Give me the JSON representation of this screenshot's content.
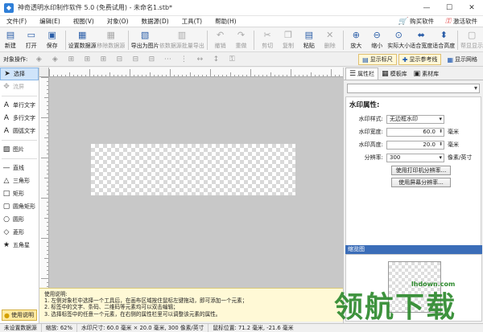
{
  "window": {
    "title": "神奇透明水印制作软件 5.0 (免费试用) - 未命名1.stb*",
    "minimize": "—",
    "maximize": "☐",
    "close": "✕"
  },
  "menu": {
    "items": [
      "文件(F)",
      "编辑(E)",
      "视图(V)",
      "对象(O)",
      "数据源(D)",
      "工具(T)",
      "帮助(H)"
    ],
    "buy": "购买软件",
    "activate": "激活软件"
  },
  "toolbar": [
    {
      "label": "新建",
      "icon": "new-file-icon",
      "glyph": "▤",
      "disabled": false
    },
    {
      "label": "打开",
      "icon": "open-folder-icon",
      "glyph": "▭",
      "disabled": false
    },
    {
      "label": "保存",
      "icon": "save-icon",
      "glyph": "▣",
      "disabled": false
    },
    {
      "label": "设置数据源",
      "icon": "datasource-icon",
      "glyph": "▦",
      "disabled": false
    },
    {
      "label": "移除数据源",
      "icon": "remove-datasource-icon",
      "glyph": "▦",
      "disabled": true
    },
    {
      "label": "导出为图片",
      "icon": "export-image-icon",
      "glyph": "▧",
      "disabled": false
    },
    {
      "label": "依数据源批量导出",
      "icon": "batch-export-icon",
      "glyph": "▥",
      "disabled": true
    },
    {
      "label": "撤销",
      "icon": "undo-icon",
      "glyph": "↶",
      "disabled": true
    },
    {
      "label": "重做",
      "icon": "redo-icon",
      "glyph": "↷",
      "disabled": true
    },
    {
      "label": "剪切",
      "icon": "cut-icon",
      "glyph": "✂",
      "disabled": true
    },
    {
      "label": "复制",
      "icon": "copy-icon",
      "glyph": "❐",
      "disabled": true
    },
    {
      "label": "粘贴",
      "icon": "paste-icon",
      "glyph": "▤",
      "disabled": false
    },
    {
      "label": "删除",
      "icon": "delete-icon",
      "glyph": "✕",
      "disabled": true
    },
    {
      "label": "放大",
      "icon": "zoom-in-icon",
      "glyph": "⊕",
      "disabled": false
    },
    {
      "label": "缩小",
      "icon": "zoom-out-icon",
      "glyph": "⊖",
      "disabled": false
    },
    {
      "label": "实际大小",
      "icon": "actual-size-icon",
      "glyph": "⊙",
      "disabled": false
    },
    {
      "label": "适合宽度",
      "icon": "fit-width-icon",
      "glyph": "⬌",
      "disabled": false
    },
    {
      "label": "适合高度",
      "icon": "fit-height-icon",
      "glyph": "⬍",
      "disabled": false
    },
    {
      "label": "帮显显示",
      "icon": "display-icon",
      "glyph": "▢",
      "disabled": true
    }
  ],
  "toolbar2": {
    "label": "对象操作:",
    "show_ruler": "显示标尺",
    "show_ref": "显示参考线",
    "show_grid": "显示网格"
  },
  "tools": [
    {
      "label": "选择",
      "icon": "pointer-icon",
      "glyph": "➤",
      "selected": true,
      "dim": false
    },
    {
      "label": "流屏",
      "icon": "pan-icon",
      "glyph": "✥",
      "selected": false,
      "dim": true
    },
    {
      "label": "单行文字",
      "icon": "single-text-icon",
      "glyph": "A",
      "selected": false,
      "dim": false
    },
    {
      "label": "多行文字",
      "icon": "multi-text-icon",
      "glyph": "A",
      "selected": false,
      "dim": false
    },
    {
      "label": "圆弧文字",
      "icon": "arc-text-icon",
      "glyph": "A",
      "selected": false,
      "dim": false
    },
    {
      "label": "图片",
      "icon": "image-icon",
      "glyph": "▨",
      "selected": false,
      "dim": false
    },
    {
      "label": "直线",
      "icon": "line-icon",
      "glyph": "—",
      "selected": false,
      "dim": false
    },
    {
      "label": "三角形",
      "icon": "triangle-icon",
      "glyph": "△",
      "selected": false,
      "dim": false
    },
    {
      "label": "矩形",
      "icon": "rectangle-icon",
      "glyph": "□",
      "selected": false,
      "dim": false
    },
    {
      "label": "圆角矩形",
      "icon": "rounded-rect-icon",
      "glyph": "▢",
      "selected": false,
      "dim": false
    },
    {
      "label": "圆形",
      "icon": "circle-icon",
      "glyph": "○",
      "selected": false,
      "dim": false
    },
    {
      "label": "菱形",
      "icon": "diamond-icon",
      "glyph": "◇",
      "selected": false,
      "dim": false
    },
    {
      "label": "五角星",
      "icon": "star-icon",
      "glyph": "★",
      "selected": false,
      "dim": false
    }
  ],
  "help_button": "使用说明",
  "help_text": {
    "title": "使用说明:",
    "lines": [
      "1. 左侧对象栏中选择一个工具后，在画布区域按住鼠标左键拖动，即可添加一个元素；",
      "2. 标签中的文字、条码、二维码等元素均可以双击编辑；",
      "3. 选择标签中的任意一个元素，在右侧的属性栏里可以调整该元素的属性。"
    ]
  },
  "right_tabs": [
    {
      "label": "属性栏",
      "icon": "properties-icon",
      "glyph": "☰",
      "active": true
    },
    {
      "label": "模板库",
      "icon": "template-icon",
      "glyph": "▦",
      "active": false
    },
    {
      "label": "素材库",
      "icon": "material-icon",
      "glyph": "▣",
      "active": false
    }
  ],
  "props": {
    "title": "水印属性:",
    "style_label": "水印样式:",
    "style_value": "无边框水印",
    "width_label": "水印宽度:",
    "width_value": "60.0",
    "width_unit": "毫米",
    "height_label": "水印高度:",
    "height_value": "20.0",
    "height_unit": "毫米",
    "res_label": "分辨率:",
    "res_value": "300",
    "res_unit": "像素/英寸",
    "btn_printer": "使用打印机分辨率...",
    "btn_screen": "使用屏幕分辨率..."
  },
  "preview_title": "缩览图",
  "status": {
    "mode": "未设置数据源",
    "zoom": "缩放: 62%",
    "size": "水印尺寸: 60.0 毫米 × 20.0 毫米, 300 像素/英寸",
    "coords": "鼠标位置: 71.2 毫米, -21.6 毫米"
  },
  "watermark": {
    "text": "领航下载",
    "site": "lhdown.com"
  }
}
